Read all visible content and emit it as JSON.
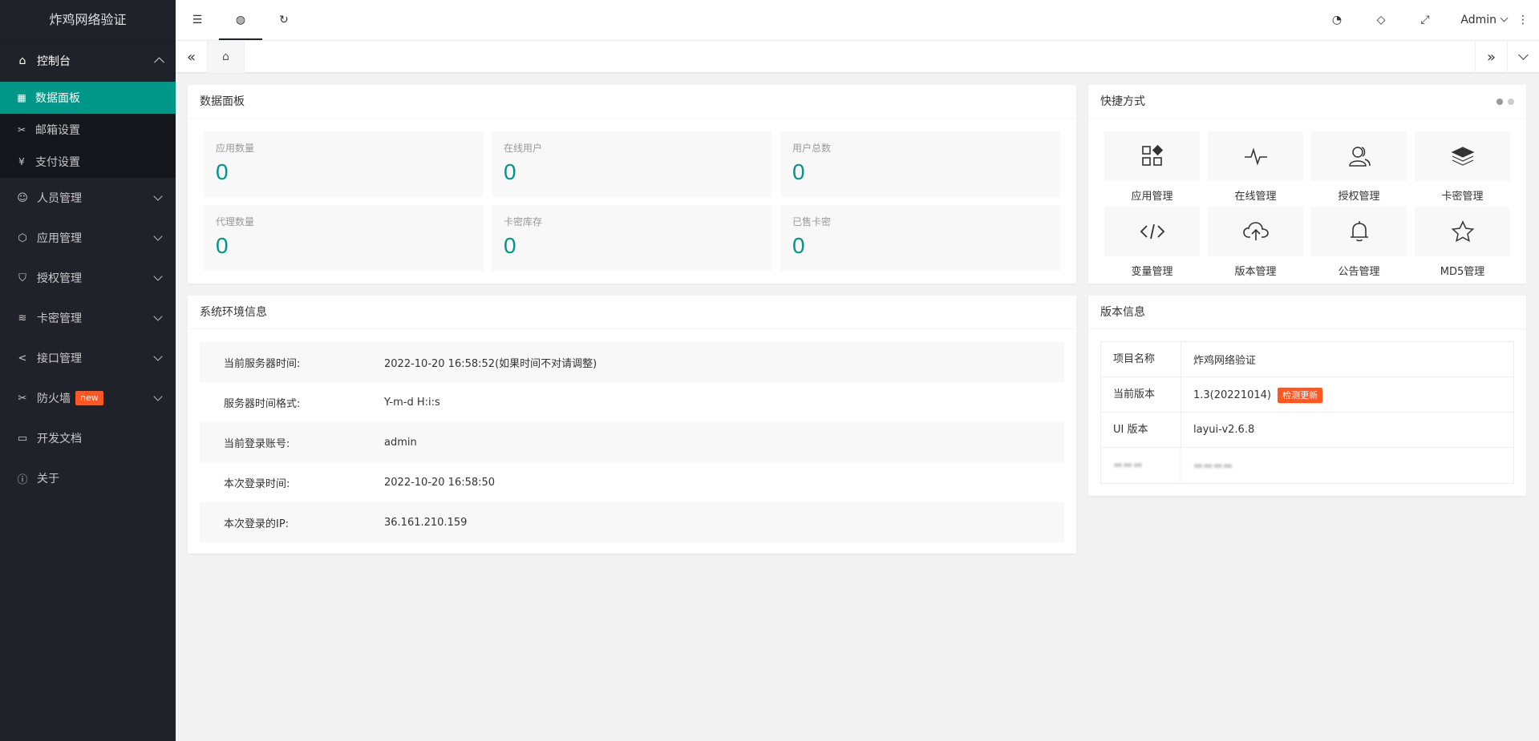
{
  "app": {
    "title": "炸鸡网络验证"
  },
  "sidebar": {
    "console": {
      "label": "控制台"
    },
    "sub_items": [
      {
        "label": "数据面板",
        "icon": "windows-icon"
      },
      {
        "label": "邮箱设置",
        "icon": "tools-icon"
      },
      {
        "label": "支付设置",
        "icon": "yen-icon"
      }
    ],
    "items": [
      {
        "label": "人员管理",
        "icon": "user-icon"
      },
      {
        "label": "应用管理",
        "icon": "cube-icon"
      },
      {
        "label": "授权管理",
        "icon": "shield-icon"
      },
      {
        "label": "卡密管理",
        "icon": "layers-icon"
      },
      {
        "label": "接口管理",
        "icon": "share-icon"
      },
      {
        "label": "防火墙",
        "icon": "tools-icon",
        "badge": "new"
      },
      {
        "label": "开发文档",
        "icon": "book-icon"
      },
      {
        "label": "关于",
        "icon": "info-icon"
      }
    ]
  },
  "header": {
    "user": "Admin"
  },
  "dashboard": {
    "title": "数据面板",
    "stats": [
      {
        "label": "应用数量",
        "value": "0"
      },
      {
        "label": "在线用户",
        "value": "0"
      },
      {
        "label": "用户总数",
        "value": "0"
      },
      {
        "label": "代理数量",
        "value": "0"
      },
      {
        "label": "卡密库存",
        "value": "0"
      },
      {
        "label": "已售卡密",
        "value": "0"
      }
    ]
  },
  "shortcuts": {
    "title": "快捷方式",
    "items": [
      {
        "label": "应用管理",
        "icon": "apps-icon"
      },
      {
        "label": "在线管理",
        "icon": "pulse-icon"
      },
      {
        "label": "授权管理",
        "icon": "users-icon"
      },
      {
        "label": "卡密管理",
        "icon": "layers-icon"
      },
      {
        "label": "变量管理",
        "icon": "code-icon"
      },
      {
        "label": "版本管理",
        "icon": "cloud-upload-icon"
      },
      {
        "label": "公告管理",
        "icon": "bell-icon"
      },
      {
        "label": "MD5管理",
        "icon": "star-icon"
      }
    ]
  },
  "env": {
    "title": "系统环境信息",
    "rows": [
      {
        "key": "当前服务器时间:",
        "value": "2022-10-20 16:58:52(如果时间不对请调整)"
      },
      {
        "key": "服务器时间格式:",
        "value": "Y-m-d H:i:s"
      },
      {
        "key": "当前登录账号:",
        "value": "admin"
      },
      {
        "key": "本次登录时间:",
        "value": "2022-10-20 16:58:50"
      },
      {
        "key": "本次登录的IP:",
        "value": "36.161.210.159"
      }
    ]
  },
  "version": {
    "title": "版本信息",
    "rows": [
      {
        "key": "项目名称",
        "value": "炸鸡网络验证"
      },
      {
        "key": "当前版本",
        "value": "1.3(20221014)",
        "action": "检测更新"
      },
      {
        "key": "UI 版本",
        "value": "layui-v2.6.8"
      }
    ]
  },
  "colors": {
    "accent": "#009688",
    "sidebar": "#20222a",
    "badge": "#ff5722"
  }
}
